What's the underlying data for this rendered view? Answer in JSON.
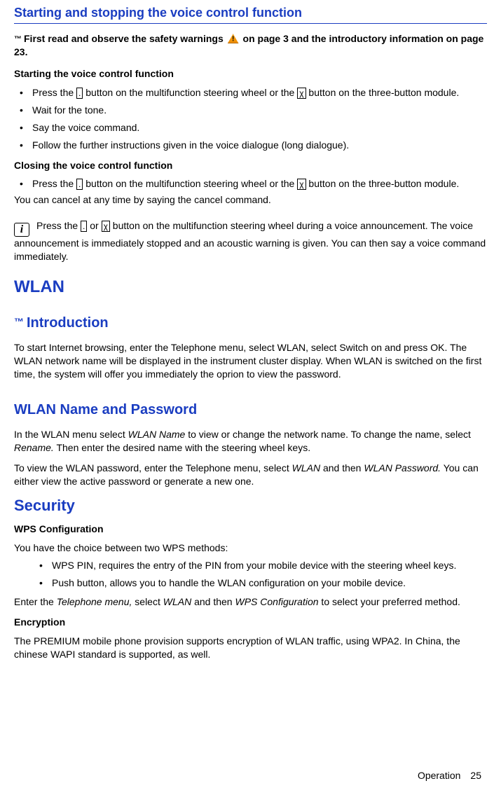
{
  "section1": {
    "title": "Starting and stopping the voice control function",
    "safety": {
      "tm": "™",
      "prefix": "First read and observe the safety warnings ",
      "suffix": " on page 3 and the introductory information on page 23."
    },
    "start": {
      "heading": "Starting the voice control function",
      "items": [
        {
          "pre": "Press the ",
          "btn1": ".",
          "mid": " button on the multifunction steering wheel or the ",
          "btn2": "χ",
          "post": " button on the three-button module."
        },
        {
          "text": "Wait for the tone."
        },
        {
          "text": "Say the voice command."
        },
        {
          "text": "Follow the further instructions given in the voice dialogue (long dialogue)."
        }
      ]
    },
    "close": {
      "heading": "Closing the voice control function",
      "item": {
        "pre": "Press the ",
        "btn1": ".",
        "mid": " button on the multifunction steering wheel or the ",
        "btn2": "χ",
        "post": " button on the three-button module."
      },
      "followup": "You can cancel at any time by saying the cancel command."
    },
    "info": {
      "icon": "i",
      "pre": "Press the ",
      "btn1": ".",
      "or": " or ",
      "btn2": "χ",
      "post": " button on the multifunction steering wheel during a voice announcement. The voice announcement is immediately stopped and an acoustic warning is given. You can then say a voice command immediately."
    }
  },
  "wlan": {
    "title": "WLAN"
  },
  "intro": {
    "tm": "™",
    "title": "Introduction",
    "body": "To start Internet browsing, enter the Telephone menu, select WLAN, select Switch on  and press OK. The WLAN network name will be displayed in the instrument cluster display. When WLAN is switched on the first time, the system will offer you immediately the oprion to view the password."
  },
  "namepwd": {
    "title": "WLAN Name and Password",
    "p1a": "In the WLAN menu select ",
    "p1i": "WLAN Name",
    "p1b": " to view or change the network name. To change the name, select ",
    "p1i2": "Rename.",
    "p1c": " Then enter the desired name with the steering wheel keys.",
    "p2a": "To view the WLAN password, enter the Telephone menu, select ",
    "p2i": "WLAN",
    "p2b": " and then ",
    "p2i2": "WLAN Password.",
    "p2c": " You can either view the active password or generate a new one."
  },
  "security": {
    "title": "Security",
    "wps_heading": "WPS Configuration",
    "wps_intro": "You have the choice between two WPS methods:",
    "wps_items": [
      "WPS PIN, requires the entry of the PIN from your mobile device with the steering wheel keys.",
      "Push button, allows you to handle the WLAN configuration on your mobile device."
    ],
    "wps_p_a": "Enter the ",
    "wps_p_i1": "Telephone menu,",
    "wps_p_b": " select ",
    "wps_p_i2": "WLAN",
    "wps_p_c": " and then ",
    "wps_p_i3": "WPS Configuration",
    "wps_p_d": " to select your preferred method.",
    "enc_heading": "Encryption",
    "enc_body": "The PREMIUM mobile phone provision supports encryption of WLAN traffic, using WPA2. In China, the chinese WAPI standard is supported, as well."
  },
  "footer": {
    "label": "Operation",
    "page": "25"
  }
}
